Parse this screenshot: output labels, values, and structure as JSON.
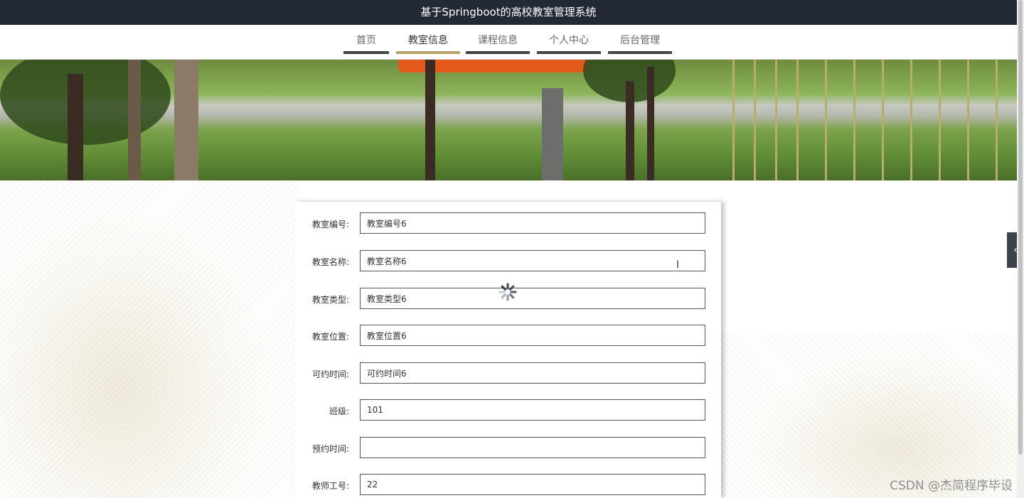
{
  "header": {
    "title": "基于Springboot的高校教室管理系统"
  },
  "nav": {
    "items": [
      {
        "label": "首页"
      },
      {
        "label": "教室信息"
      },
      {
        "label": "课程信息"
      },
      {
        "label": "个人中心"
      },
      {
        "label": "后台管理"
      }
    ]
  },
  "form": {
    "fields": [
      {
        "label": "教室编号:",
        "value": "教室编号6"
      },
      {
        "label": "教室名称:",
        "value": "教室名称6"
      },
      {
        "label": "教室类型:",
        "value": "教室类型6"
      },
      {
        "label": "教室位置:",
        "value": "教室位置6"
      },
      {
        "label": "可约时间:",
        "value": "可约时间6"
      },
      {
        "label": "班级:",
        "value": "101"
      },
      {
        "label": "预约时间:",
        "value": ""
      },
      {
        "label": "教师工号:",
        "value": "22"
      }
    ]
  },
  "side_tab": {
    "icon": "chevron-left-icon",
    "glyph": "‹"
  },
  "watermark": "CSDN @杰简程序毕设",
  "colors": {
    "topbar": "#232a36",
    "nav_active_underline": "#b9a06a",
    "nav_underline": "#444444"
  }
}
